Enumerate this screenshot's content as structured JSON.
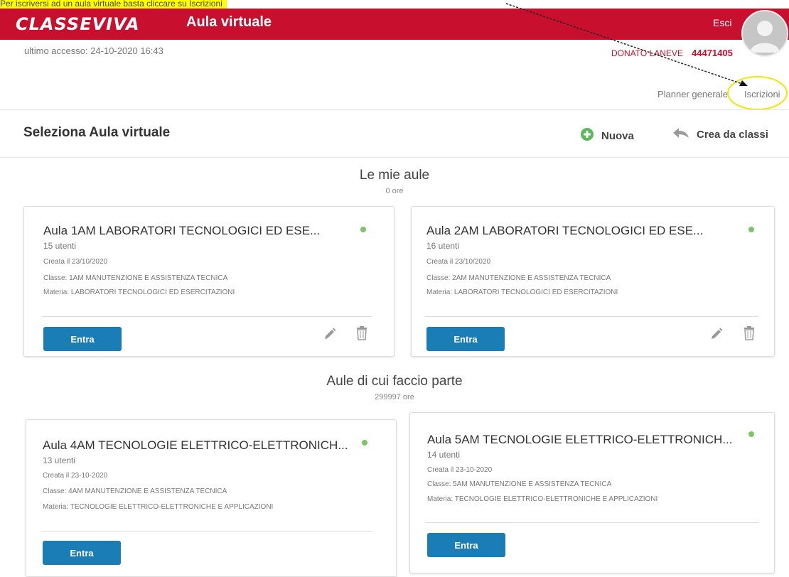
{
  "annotation": {
    "text": "Per iscriversi ad un aula virtuale basta cliccare su Iscrizioni"
  },
  "header": {
    "logo": "CLASSEVIVA",
    "title": "Aula virtuale",
    "logout_label": "Esci",
    "last_access": "ultimo accesso: 24-10-2020 16:43",
    "user_name": "DONATO LANEVE",
    "user_code": "44471405",
    "avatar_icon": "user-avatar-icon"
  },
  "nav": {
    "planner_label": "Planner generale",
    "iscrizioni_label": "Iscrizioni"
  },
  "toolbar": {
    "title": "Seleziona Aula virtuale",
    "new_label": "Nuova",
    "new_icon": "plus-circle-icon",
    "create_label": "Crea da classi",
    "create_icon": "reply-arrow-icon"
  },
  "colors": {
    "brand_red": "#c8102e",
    "button_blue": "#1a7db5",
    "status_green": "#7cc36a",
    "highlight_yellow": "#ffff00"
  },
  "my_rooms": {
    "title": "Le mie aule",
    "hours": "0 ore",
    "cards": [
      {
        "title": "Aula 1AM LABORATORI TECNOLOGICI ED ESE...",
        "users": "15 utenti",
        "created": "Creata il 23/10/2020",
        "class": "Classe: 1AM MANUTENZIONE E ASSISTENZA TECNICA",
        "subject": "Materia: LABORATORI TECNOLOGICI ED ESERCITAZIONI",
        "enter_label": "Entra",
        "edit_icon": "pencil-icon",
        "delete_icon": "trash-icon"
      },
      {
        "title": "Aula 2AM LABORATORI TECNOLOGICI ED ESE...",
        "users": "16 utenti",
        "created": "Creata il 23/10/2020",
        "class": "Classe: 2AM MANUTENZIONE E ASSISTENZA TECNICA",
        "subject": "Materia: LABORATORI TECNOLOGICI ED ESERCITAZIONI",
        "enter_label": "Entra",
        "edit_icon": "pencil-icon",
        "delete_icon": "trash-icon"
      }
    ]
  },
  "member_rooms": {
    "title": "Aule di cui faccio parte",
    "hours": "299997 ore",
    "cards": [
      {
        "title": "Aula 4AM TECNOLOGIE ELETTRICO-ELETTRONICH...",
        "users": "13 utenti",
        "created": "Creata il 23-10-2020",
        "class": "Classe: 4AM MANUTENZIONE E ASSISTENZA TECNICA",
        "subject": "Materia: TECNOLOGIE ELETTRICO-ELETTRONICHE E APPLICAZIONI",
        "enter_label": "Entra"
      },
      {
        "title": "Aula 5AM TECNOLOGIE ELETTRICO-ELETTRONICH...",
        "users": "14 utenti",
        "created": "Creata il 23-10-2020",
        "class": "Classe: 5AM MANUTENZIONE E ASSISTENZA TECNICA",
        "subject": "Materia: TECNOLOGIE ELETTRICO-ELETTRONICHE E APPLICAZIONI",
        "enter_label": "Entra"
      }
    ]
  }
}
